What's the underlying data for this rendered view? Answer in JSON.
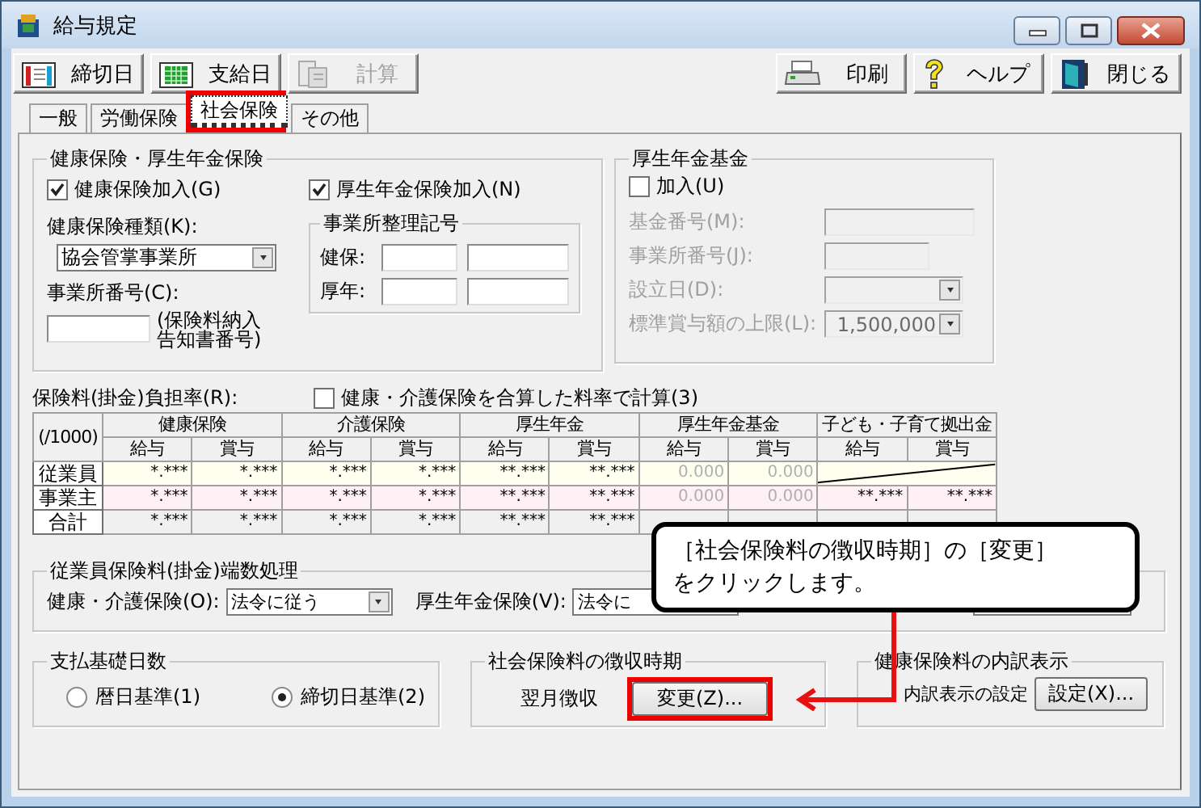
{
  "window": {
    "title": "給与規定"
  },
  "toolbar": {
    "left": [
      {
        "label": "締切日",
        "kind": "calendar",
        "disabled": false
      },
      {
        "label": "支給日",
        "kind": "grid",
        "disabled": false
      },
      {
        "label": "計算",
        "kind": "calculator",
        "disabled": true
      }
    ],
    "right": [
      {
        "label": "印刷",
        "kind": "printer",
        "disabled": false
      },
      {
        "label": "ヘルプ",
        "kind": "help",
        "disabled": false
      },
      {
        "label": "閉じる",
        "kind": "exit",
        "disabled": false
      }
    ]
  },
  "tabs": [
    {
      "label": "一般",
      "selected": false,
      "highlighted": false
    },
    {
      "label": "労働保険",
      "selected": false,
      "highlighted": false
    },
    {
      "label": "社会保険",
      "selected": true,
      "highlighted": true
    },
    {
      "label": "その他",
      "selected": false,
      "highlighted": false
    }
  ],
  "health_pension": {
    "title": "健康保険・厚生年金保険",
    "checkboxes": [
      {
        "label": "健康保険加入(G)",
        "checked": true
      },
      {
        "label": "厚生年金保険加入(N)",
        "checked": true
      }
    ],
    "type_label": "健康保険種類(K):",
    "type_value": "協会管掌事業所",
    "office_label": "事業所番号(C):",
    "office_note": [
      "(保険料納入",
      "告知書番号)"
    ],
    "registry": {
      "title": "事業所整理記号",
      "rows": [
        "健保:",
        "厚年:"
      ]
    }
  },
  "fund": {
    "title": "厚生年金基金",
    "checkbox": {
      "label": "加入(U)",
      "checked": false
    },
    "disabled": true,
    "fields": [
      {
        "label": "基金番号(M):",
        "kind": "input"
      },
      {
        "label": "事業所番号(J):",
        "kind": "short"
      },
      {
        "label": "設立日(D):",
        "kind": "select"
      },
      {
        "label": "標準賞与額の上限(L):",
        "kind": "select",
        "value": "1,500,000"
      }
    ]
  },
  "rates": {
    "label": "保険料(掛金)負担率(R):",
    "combine": {
      "label": "健康・介護保険を合算した料率で計算(3)",
      "checked": false
    },
    "corner": "(/1000)",
    "groups": [
      "健康保険",
      "介護保険",
      "厚生年金",
      "厚生年金基金",
      "子ども・子育て拠出金"
    ],
    "subheads": [
      "給与",
      "賞与",
      "給与",
      "賞与",
      "給与",
      "賞与",
      "給与",
      "賞与",
      "給与",
      "賞与"
    ],
    "rows": [
      {
        "label": "従業員",
        "kind": "employee",
        "cells": [
          {
            "kind": "value",
            "text": "*.***",
            "disabled": false
          },
          {
            "kind": "value",
            "text": "*.***",
            "disabled": false
          },
          {
            "kind": "value",
            "text": "*.***",
            "disabled": false
          },
          {
            "kind": "value",
            "text": "*.***",
            "disabled": false
          },
          {
            "kind": "value",
            "text": "**.***",
            "disabled": false
          },
          {
            "kind": "value",
            "text": "**.***",
            "disabled": false
          },
          {
            "kind": "value",
            "text": "0.000",
            "disabled": true
          },
          {
            "kind": "value",
            "text": "0.000",
            "disabled": true
          },
          {
            "kind": "slash"
          }
        ]
      },
      {
        "label": "事業主",
        "kind": "employer",
        "cells": [
          {
            "kind": "value",
            "text": "*.***",
            "disabled": false
          },
          {
            "kind": "value",
            "text": "*.***",
            "disabled": false
          },
          {
            "kind": "value",
            "text": "*.***",
            "disabled": false
          },
          {
            "kind": "value",
            "text": "*.***",
            "disabled": false
          },
          {
            "kind": "value",
            "text": "**.***",
            "disabled": false
          },
          {
            "kind": "value",
            "text": "**.***",
            "disabled": false
          },
          {
            "kind": "value",
            "text": "0.000",
            "disabled": true
          },
          {
            "kind": "value",
            "text": "0.000",
            "disabled": true
          },
          {
            "kind": "value",
            "text": "**.***",
            "disabled": false
          },
          {
            "kind": "value",
            "text": "**.***",
            "disabled": false
          }
        ]
      },
      {
        "label": "合計",
        "kind": "total",
        "cells": [
          {
            "kind": "value",
            "text": "*.***",
            "disabled": false
          },
          {
            "kind": "value",
            "text": "*.***",
            "disabled": false
          },
          {
            "kind": "value",
            "text": "*.***",
            "disabled": false
          },
          {
            "kind": "value",
            "text": "*.***",
            "disabled": false
          },
          {
            "kind": "value",
            "text": "**.***",
            "disabled": false
          },
          {
            "kind": "value",
            "text": "**.***",
            "disabled": false
          },
          {
            "kind": "covered"
          },
          {
            "kind": "covered"
          },
          {
            "kind": "covered"
          },
          {
            "kind": "covered"
          }
        ]
      }
    ]
  },
  "rounding": {
    "title": "従業員保険料(掛金)端数処理",
    "items": [
      {
        "label": "健康・介護保険(O):",
        "value": "法令に従う"
      },
      {
        "label": "厚生年金保険(V):",
        "value": "法令に"
      }
    ]
  },
  "pay_days": {
    "title": "支払基礎日数",
    "options": [
      {
        "label": "暦日基準(1)",
        "selected": false
      },
      {
        "label": "締切日基準(2)",
        "selected": true
      }
    ]
  },
  "collection": {
    "title": "社会保険料の徴収時期",
    "value": "翌月徴収",
    "button": {
      "label": "変更(Z)...",
      "highlighted": true
    }
  },
  "breakdown": {
    "title": "健康保険料の内訳表示",
    "label": "内訳表示の設定",
    "button": {
      "label": "設定(X)..."
    }
  },
  "callout": {
    "lines": [
      "［社会保険料の徴収時期］の［変更］",
      "をクリックします。"
    ]
  }
}
